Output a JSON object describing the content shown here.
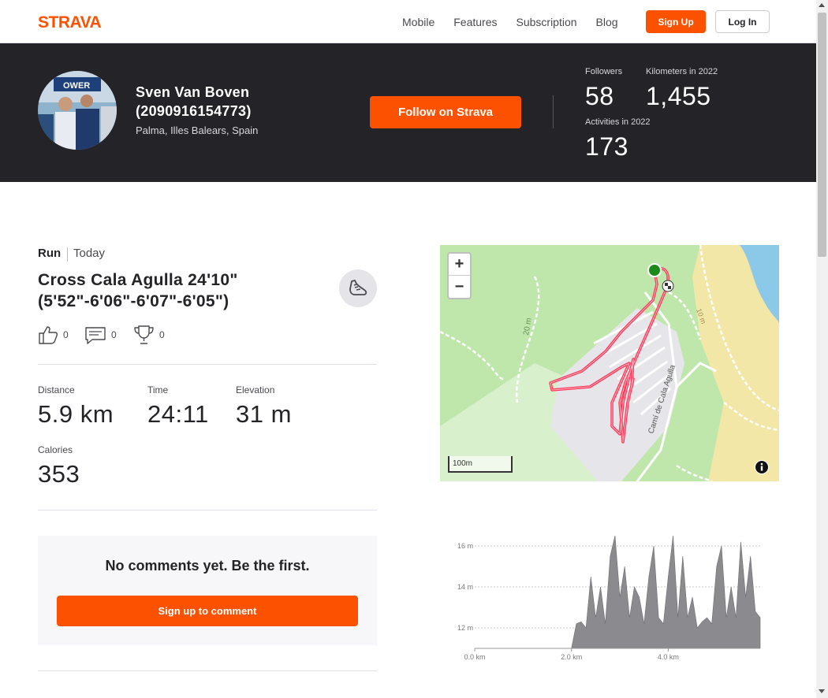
{
  "header": {
    "brand": "STRAVA",
    "nav": [
      "Mobile",
      "Features",
      "Subscription",
      "Blog"
    ],
    "signup_label": "Sign Up",
    "login_label": "Log In"
  },
  "athlete": {
    "name": "Sven Van Boven (2090916154773)",
    "location": "Palma, Illes Balears, Spain",
    "follow_label": "Follow on Strava",
    "stats": {
      "followers_label": "Followers",
      "followers_value": "58",
      "km_label": "Kilometers in 2022",
      "km_value": "1,455",
      "activities_label": "Activities in 2022",
      "activities_value": "173"
    }
  },
  "activity": {
    "type": "Run",
    "date": "Today",
    "title": "Cross Cala Agulla 24'10\" (5'52\"-6'06\"-6'07\"-6'05\")",
    "sport_icon": "shoe-icon",
    "kudos": "0",
    "comments": "0",
    "achievements": "0",
    "metrics": {
      "distance_label": "Distance",
      "distance_value": "5.9 km",
      "time_label": "Time",
      "time_value": "24:11",
      "elevation_label": "Elevation",
      "elevation_value": "31 m",
      "calories_label": "Calories",
      "calories_value": "353"
    },
    "no_comments": "No comments yet. Be the first.",
    "comment_button": "Sign up to comment"
  },
  "map": {
    "zoom_in": "+",
    "zoom_out": "−",
    "scale": "100m",
    "street_label": "Camí de Cala Agulla",
    "contour_labels": [
      "20 m",
      "10 m"
    ]
  },
  "chart_data": {
    "type": "area",
    "title": "",
    "xlabel": "",
    "ylabel": "",
    "x_ticks": [
      "0.0 km",
      "2.0 km",
      "4.0 km"
    ],
    "y_ticks": [
      "12 m",
      "14 m",
      "16 m"
    ],
    "xlim": [
      0,
      5.9
    ],
    "ylim": [
      11,
      17
    ],
    "grid": true,
    "series": [
      {
        "x": [
          0.0,
          2.0,
          2.1,
          2.2,
          2.3,
          2.4,
          2.5,
          2.6,
          2.7,
          2.8,
          2.9,
          3.0,
          3.1,
          3.2,
          3.3,
          3.4,
          3.5,
          3.6,
          3.7,
          3.8,
          3.9,
          4.0,
          4.1,
          4.2,
          4.3,
          4.4,
          4.5,
          4.6,
          4.7,
          4.8,
          4.9,
          5.0,
          5.1,
          5.2,
          5.3,
          5.4,
          5.5,
          5.6,
          5.7,
          5.8,
          5.9
        ],
        "y": [
          11.0,
          11.0,
          12.2,
          12.3,
          12.0,
          14.5,
          12.5,
          14.0,
          12.2,
          15.5,
          16.5,
          13.5,
          15.0,
          12.5,
          14.0,
          13.5,
          12.2,
          14.5,
          16.0,
          12.5,
          12.2,
          14.5,
          16.5,
          12.5,
          15.5,
          12.5,
          13.5,
          12.0,
          12.3,
          12.5,
          12.2,
          15.0,
          16.0,
          12.5,
          14.0,
          12.5,
          16.2,
          13.5,
          15.5,
          12.8,
          12.5
        ]
      }
    ]
  }
}
